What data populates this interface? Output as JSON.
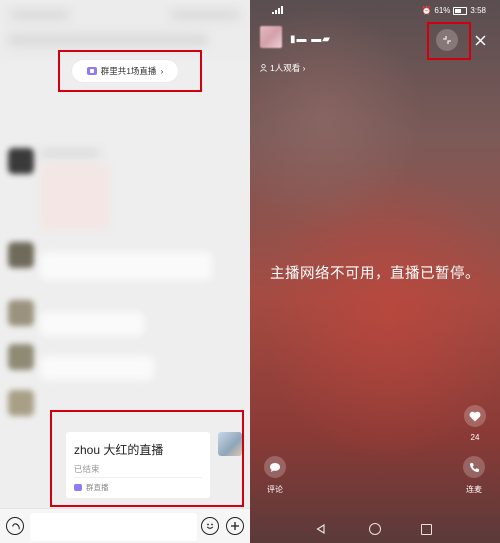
{
  "left_panel": {
    "live_banner": {
      "label": "群里共1场直播",
      "chevron": "›"
    },
    "live_card": {
      "title": "zhou 大红的直播",
      "status": "已结束",
      "footer": "群直播"
    },
    "input_bar": {
      "placeholder": ""
    }
  },
  "right_panel": {
    "status_bar": {
      "battery": "61%",
      "time": "3:58"
    },
    "host": {
      "name": "▮▬ ▬▰"
    },
    "viewers": "1人观看 ›",
    "paused_message": "主播网络不可用，直播已暂停。",
    "like": {
      "count": "24"
    },
    "comment": {
      "label": "评论"
    },
    "mic": {
      "label": "连麦"
    }
  },
  "colors": {
    "highlight_box": "#d00010",
    "live_icon": "#8e7cf0"
  }
}
